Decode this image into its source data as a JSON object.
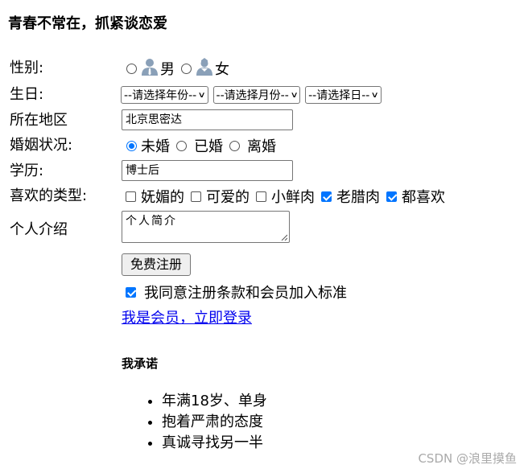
{
  "title": "青春不常在，抓紧谈恋爱",
  "labels": {
    "gender": "性别:",
    "birthday": "生日:",
    "region": "所在地区",
    "marital": "婚姻状况:",
    "education": "学历:",
    "likes": "喜欢的类型:",
    "intro": "个人介绍"
  },
  "gender": {
    "options": [
      {
        "label": "男",
        "icon": "male-person-icon",
        "checked": false
      },
      {
        "label": "女",
        "icon": "female-person-icon",
        "checked": false
      }
    ]
  },
  "birthday": {
    "year": "--请选择年份--",
    "month": "--请选择月份--",
    "day": "--请选择日--"
  },
  "region_value": "北京思密达",
  "marital": {
    "options": [
      {
        "label": "未婚",
        "checked": true
      },
      {
        "label": "已婚",
        "checked": false
      },
      {
        "label": "离婚",
        "checked": false
      }
    ]
  },
  "education_value": "博士后",
  "likes": {
    "options": [
      {
        "label": "妩媚的",
        "checked": false
      },
      {
        "label": "可爱的",
        "checked": false
      },
      {
        "label": "小鲜肉",
        "checked": false
      },
      {
        "label": "老腊肉",
        "checked": true
      },
      {
        "label": "都喜欢",
        "checked": true
      }
    ]
  },
  "intro_value": "个人简介",
  "register_button": "免费注册",
  "agree": {
    "label": "我同意注册条款和会员加入标准",
    "checked": true
  },
  "login_link": "我是会员，立即登录",
  "promise": {
    "title": "我承诺",
    "items": [
      "年满18岁、单身",
      "抱着严肃的态度",
      "真诚寻找另一半"
    ]
  },
  "watermark": "CSDN @浪里摸鱼",
  "colors": {
    "accent": "#0075ff",
    "link": "#0000ee",
    "icon": "#8aa0b8"
  }
}
